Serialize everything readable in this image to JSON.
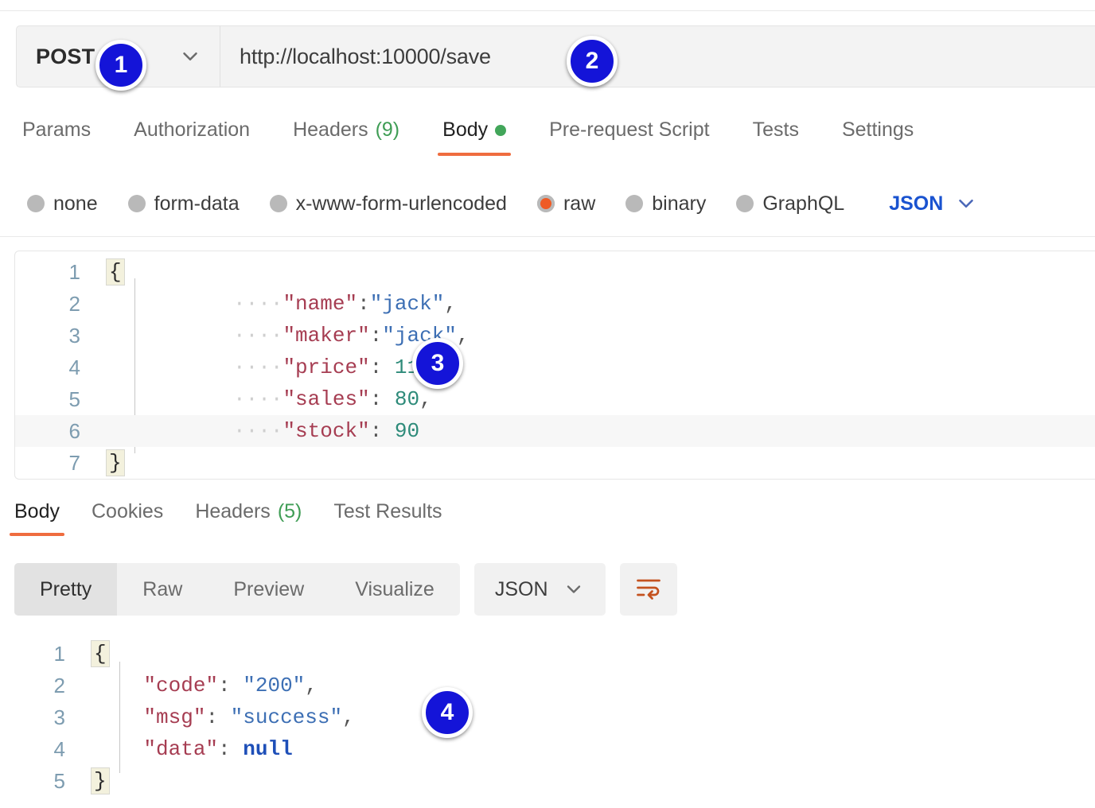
{
  "request": {
    "method": "POST",
    "method_caret_icon": "chevron-down-icon",
    "url": "http://localhost:10000/save",
    "tabs": [
      {
        "label": "Params",
        "active": false
      },
      {
        "label": "Authorization",
        "active": false
      },
      {
        "label": "Headers",
        "count": "(9)",
        "active": false
      },
      {
        "label": "Body",
        "active": true,
        "dot": "green-status-dot"
      },
      {
        "label": "Pre-request Script",
        "active": false
      },
      {
        "label": "Tests",
        "active": false
      },
      {
        "label": "Settings",
        "active": false
      }
    ],
    "body_types": [
      {
        "label": "none",
        "selected": false
      },
      {
        "label": "form-data",
        "selected": false
      },
      {
        "label": "x-www-form-urlencoded",
        "selected": false
      },
      {
        "label": "raw",
        "selected": true
      },
      {
        "label": "binary",
        "selected": false
      },
      {
        "label": "GraphQL",
        "selected": false
      }
    ],
    "raw_format": "JSON",
    "raw_format_caret_icon": "chevron-down-icon",
    "body_lines": [
      {
        "n": "1",
        "brace": "{",
        "indent": false
      },
      {
        "n": "2",
        "dots": "····",
        "key": "\"name\"",
        "colon": ":",
        "str": "\"jack\"",
        "comma": ","
      },
      {
        "n": "3",
        "dots": "····",
        "key": "\"maker\"",
        "colon": ":",
        "str": "\"jack\"",
        "comma": ","
      },
      {
        "n": "4",
        "dots": "····",
        "key": "\"price\"",
        "colon": ": ",
        "num": "11.1",
        "comma": ","
      },
      {
        "n": "5",
        "dots": "····",
        "key": "\"sales\"",
        "colon": ": ",
        "num": "80",
        "comma": ","
      },
      {
        "n": "6",
        "dots": "····",
        "key": "\"stock\"",
        "colon": ": ",
        "num": "90",
        "comma": "",
        "highlight": true
      },
      {
        "n": "7",
        "brace": "}",
        "indent": false
      }
    ]
  },
  "response": {
    "tabs": [
      {
        "label": "Body",
        "active": true
      },
      {
        "label": "Cookies",
        "active": false
      },
      {
        "label": "Headers",
        "count": "(5)",
        "active": false
      },
      {
        "label": "Test Results",
        "active": false
      }
    ],
    "view_modes": [
      {
        "label": "Pretty",
        "active": true
      },
      {
        "label": "Raw",
        "active": false
      },
      {
        "label": "Preview",
        "active": false
      },
      {
        "label": "Visualize",
        "active": false
      }
    ],
    "format": "JSON",
    "format_caret_icon": "chevron-down-icon",
    "wrap_icon": "wrap-lines-icon",
    "body_lines": [
      {
        "n": "1",
        "brace": "{"
      },
      {
        "n": "2",
        "key": "\"code\"",
        "colon": ": ",
        "str": "\"200\"",
        "comma": ","
      },
      {
        "n": "3",
        "key": "\"msg\"",
        "colon": ": ",
        "str": "\"success\"",
        "comma": ","
      },
      {
        "n": "4",
        "key": "\"data\"",
        "colon": ": ",
        "nul": "null",
        "comma": ""
      },
      {
        "n": "5",
        "brace": "}"
      }
    ]
  },
  "callouts": [
    {
      "number": "1"
    },
    {
      "number": "2"
    },
    {
      "number": "3"
    },
    {
      "number": "4"
    }
  ],
  "colors": {
    "accent_orange": "#ef6c3f",
    "raw_selected": "#ef5b25",
    "status_green": "#42a65a",
    "json_blue": "#1a53d0",
    "badge_blue": "#1414d8"
  }
}
